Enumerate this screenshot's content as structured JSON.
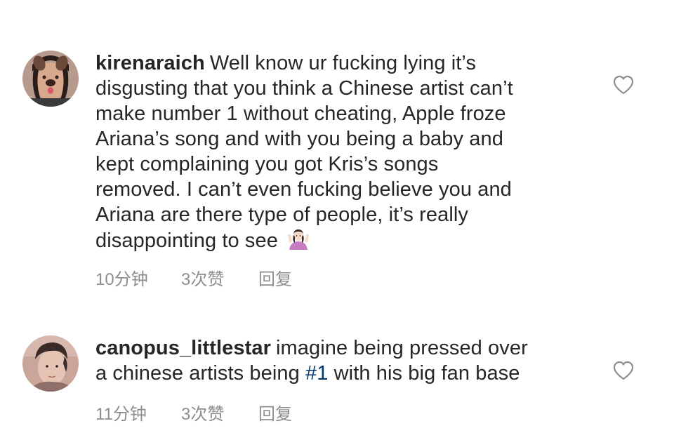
{
  "comments": [
    {
      "username": "kirenaraich",
      "lines": [
        "Well know ur fucking lying it’s",
        "disgusting that you think a Chinese artist can’t",
        "make number 1 without cheating, Apple froze",
        "Ariana’s song and with you being a baby and",
        "kept complaining you got Kris’s songs",
        "removed. I can’t even fucking believe you and",
        "Ariana are there type of people, it’s really",
        "disappointing to see"
      ],
      "emoji": "person-shrugging-emoji",
      "time": "10分钟",
      "likes": "3次赞",
      "reply_label": "回复",
      "avatar_icon": "user-avatar-dog-filter"
    },
    {
      "username": "canopus_littlestar",
      "lines_before_tag": "imagine being pressed over",
      "line2_prefix": "a chinese artists being ",
      "hashtag": "#1",
      "line2_suffix": " with his big fan base",
      "time": "11分钟",
      "likes": "3次赞",
      "reply_label": "回复",
      "avatar_icon": "user-avatar-portrait"
    }
  ],
  "colors": {
    "text": "#262626",
    "meta": "#8e8e8e",
    "hashtag": "#00376b",
    "heart_stroke": "#8e8e8e"
  },
  "icons": [
    "heart-outline-icon",
    "person-shrugging-emoji"
  ]
}
